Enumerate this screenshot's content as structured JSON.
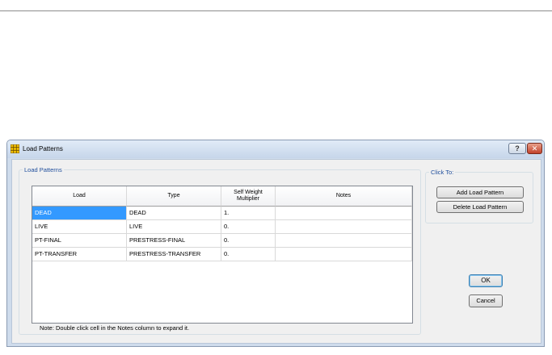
{
  "window": {
    "title": "Load Patterns",
    "help_label": "?",
    "close_label": "✕"
  },
  "load_patterns_group": {
    "legend": "Load Patterns",
    "columns": {
      "load": "Load",
      "type": "Type",
      "self_weight_line1": "Self Weight",
      "self_weight_line2": "Multiplier",
      "notes": "Notes"
    },
    "rows": [
      {
        "load": "DEAD",
        "type": "DEAD",
        "multiplier": "1.",
        "notes": ""
      },
      {
        "load": "LIVE",
        "type": "LIVE",
        "multiplier": "0.",
        "notes": ""
      },
      {
        "load": "PT-FINAL",
        "type": "PRESTRESS-FINAL",
        "multiplier": "0.",
        "notes": ""
      },
      {
        "load": "PT-TRANSFER",
        "type": "PRESTRESS-TRANSFER",
        "multiplier": "0.",
        "notes": ""
      }
    ],
    "note": "Note:  Double click cell in the Notes column to expand it."
  },
  "click_to_group": {
    "legend": "Click To:",
    "add_label": "Add Load Pattern",
    "delete_label": "Delete Load Pattern"
  },
  "ok_label": "OK",
  "cancel_label": "Cancel",
  "colors": {
    "selection": "#3399ff",
    "legend_text": "#1f4e9c",
    "frame": "#cfdcec"
  }
}
